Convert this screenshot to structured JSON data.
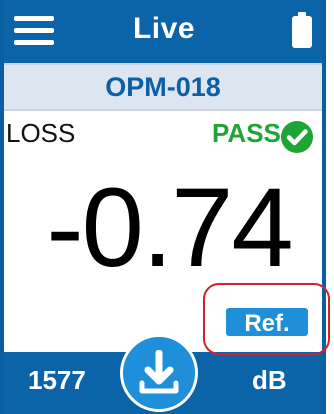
{
  "header": {
    "title": "Live",
    "menu_icon": "hamburger-menu-icon",
    "battery_icon": "battery-full-icon"
  },
  "device": {
    "name": "OPM-018"
  },
  "measurement": {
    "label": "LOSS",
    "status": "PASS",
    "status_icon": "check-circle-icon",
    "value": "-0.74",
    "unit": "dB",
    "wavelength": "1577"
  },
  "actions": {
    "ref_label": "Ref.",
    "save_icon": "download-icon"
  },
  "colors": {
    "bar_blue": "#0b63a8",
    "accent_blue": "#1e8fd8",
    "pass_green": "#1ea536",
    "highlight_red": "#d0242c",
    "device_bar": "#dde5f0"
  }
}
